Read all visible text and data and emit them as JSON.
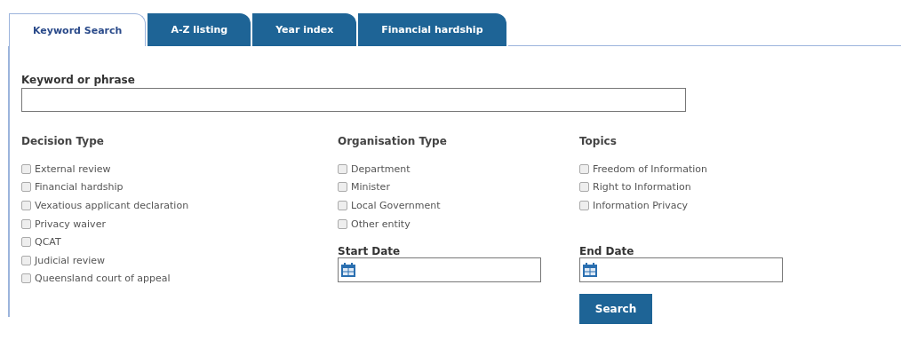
{
  "tabs": [
    {
      "label": "Keyword Search",
      "selected": true
    },
    {
      "label": "A-Z listing",
      "selected": false
    },
    {
      "label": "Year index",
      "selected": false
    },
    {
      "label": "Financial hardship",
      "selected": false
    }
  ],
  "keyword": {
    "label": "Keyword or phrase"
  },
  "groups": [
    {
      "heading": "Decision Type",
      "options": [
        {
          "label": "External review",
          "checked": false
        },
        {
          "label": "Financial hardship",
          "checked": false
        },
        {
          "label": "Vexatious applicant declaration",
          "checked": false
        },
        {
          "label": "Privacy waiver",
          "checked": false
        },
        {
          "label": "QCAT",
          "checked": false
        },
        {
          "label": "Judicial review",
          "checked": false
        },
        {
          "label": "Queensland court of appeal",
          "checked": false
        }
      ]
    },
    {
      "heading": "Organisation Type",
      "options": [
        {
          "label": "Department",
          "checked": false
        },
        {
          "label": "Minister",
          "checked": false
        },
        {
          "label": "Local Government",
          "checked": false
        },
        {
          "label": "Other entity",
          "checked": false
        }
      ]
    },
    {
      "heading": "Topics",
      "options": [
        {
          "label": "Freedom of Information",
          "checked": false
        },
        {
          "label": "Right to Information",
          "checked": false
        },
        {
          "label": "Information Privacy",
          "checked": false
        }
      ]
    }
  ],
  "start_date": {
    "label": "Start Date"
  },
  "end_date": {
    "label": "End Date"
  },
  "search_button": "Search"
}
